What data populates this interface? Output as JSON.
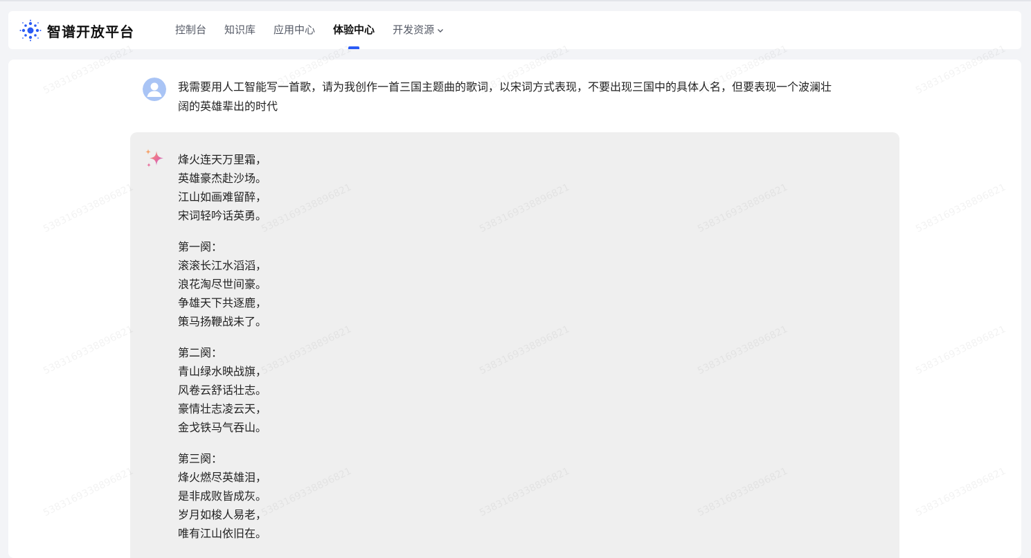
{
  "header": {
    "logo_text": "智谱开放平台",
    "nav": [
      {
        "label": "控制台",
        "active": false
      },
      {
        "label": "知识库",
        "active": false
      },
      {
        "label": "应用中心",
        "active": false
      },
      {
        "label": "体验中心",
        "active": true
      },
      {
        "label": "开发资源",
        "active": false,
        "dropdown": true
      }
    ]
  },
  "chat": {
    "user_message": "我需要用人工智能写一首歌，请为我创作一首三国主题曲的歌词，以宋词方式表现，不要出现三国中的具体人名，但要表现一个波澜壮阔的英雄辈出的时代",
    "ai_stanzas": [
      [
        "烽火连天万里霜，",
        "英雄豪杰赴沙场。",
        "江山如画难留醉，",
        "宋词轻吟话英勇。"
      ],
      [
        "第一阕：",
        "滚滚长江水滔滔，",
        "浪花淘尽世间豪。",
        "争雄天下共逐鹿，",
        "策马扬鞭战未了。"
      ],
      [
        "第二阕：",
        "青山绿水映战旗，",
        "风卷云舒话壮志。",
        "豪情壮志凌云天，",
        "金戈铁马气吞山。"
      ],
      [
        "第三阕：",
        "烽火燃尽英雄泪，",
        "是非成败皆成灰。",
        "岁月如梭人易老，",
        "唯有江山依旧在。"
      ]
    ]
  },
  "watermark_text": "5383169338896821",
  "colors": {
    "accent": "#2a5bf5",
    "ai_bubble": "#efefef",
    "page_bg": "#f3f4f7"
  }
}
